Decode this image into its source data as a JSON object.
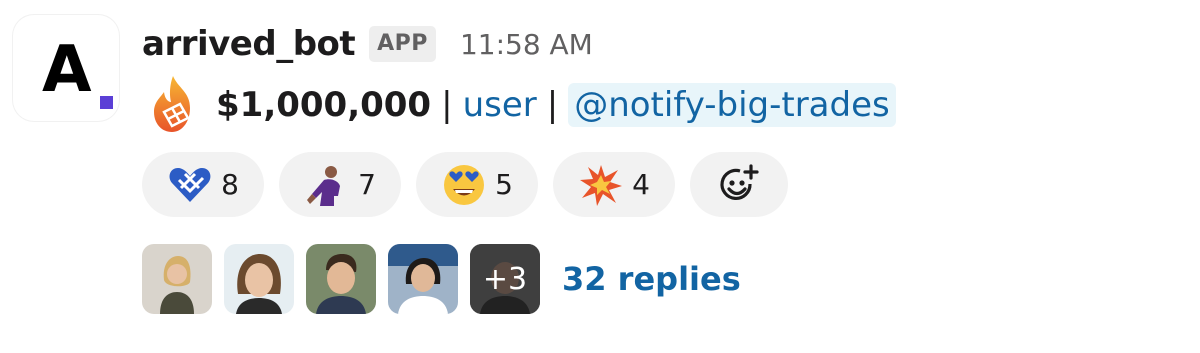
{
  "message": {
    "sender": "arrived_bot",
    "badge": "APP",
    "timestamp": "11:58 AM",
    "avatar_logo": "A",
    "body": {
      "emoji": "fire-icon",
      "amount": "$1,000,000",
      "separator": "|",
      "user_link": "user",
      "mention": "@notify-big-trades"
    },
    "reactions": [
      {
        "emoji": "heart-icon",
        "count": "8"
      },
      {
        "emoji": "person-icon",
        "count": "7"
      },
      {
        "emoji": "heart-eyes-icon",
        "count": "5"
      },
      {
        "emoji": "boom-icon",
        "count": "4"
      }
    ],
    "add_reaction_icon": "add-reaction-icon",
    "replies": {
      "more_avatars": "+3",
      "count_text": "32 replies"
    }
  },
  "colors": {
    "link": "#1264a3",
    "mention_bg": "#e8f5fa",
    "reaction_bg": "#f2f2f2",
    "badge_bg": "#eeeeee",
    "logo_dot": "#5b3fd6"
  }
}
